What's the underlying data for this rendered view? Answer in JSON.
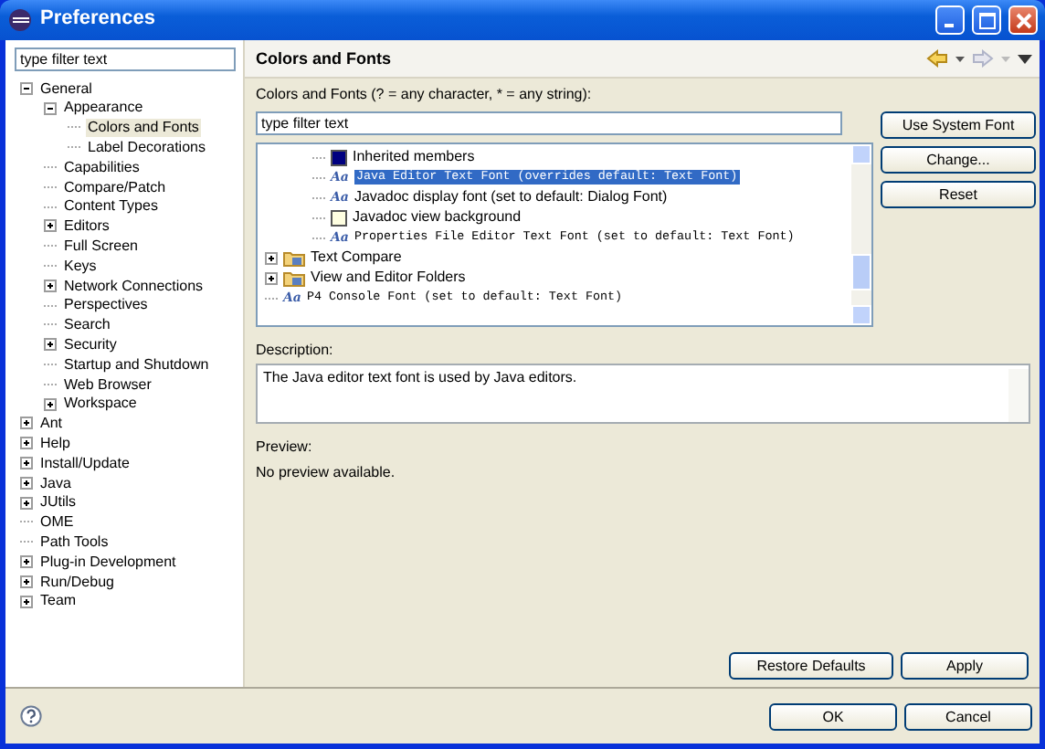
{
  "window": {
    "title": "Preferences"
  },
  "sidebar": {
    "filter": {
      "value": "type filter text"
    },
    "tree": [
      {
        "label": "General",
        "expanded": true,
        "selected": false,
        "children": [
          {
            "label": "Appearance",
            "expanded": true,
            "selected": false,
            "children": [
              {
                "label": "Colors and Fonts",
                "selected": true
              },
              {
                "label": "Label Decorations",
                "selected": false
              }
            ]
          },
          {
            "label": "Capabilities",
            "selected": false
          },
          {
            "label": "Compare/Patch",
            "selected": false
          },
          {
            "label": "Content Types",
            "selected": false
          },
          {
            "label": "Editors",
            "expanded": false,
            "selected": false
          },
          {
            "label": "Full Screen",
            "selected": false
          },
          {
            "label": "Keys",
            "selected": false
          },
          {
            "label": "Network Connections",
            "expanded": false,
            "selected": false
          },
          {
            "label": "Perspectives",
            "selected": false
          },
          {
            "label": "Search",
            "selected": false
          },
          {
            "label": "Security",
            "expanded": false,
            "selected": false
          },
          {
            "label": "Startup and Shutdown",
            "selected": false
          },
          {
            "label": "Web Browser",
            "selected": false
          },
          {
            "label": "Workspace",
            "expanded": false,
            "selected": false
          }
        ]
      },
      {
        "label": "Ant",
        "expanded": false,
        "selected": false
      },
      {
        "label": "Help",
        "expanded": false,
        "selected": false
      },
      {
        "label": "Install/Update",
        "expanded": false,
        "selected": false
      },
      {
        "label": "Java",
        "expanded": false,
        "selected": false
      },
      {
        "label": "JUtils",
        "expanded": false,
        "selected": false
      },
      {
        "label": "OME",
        "selected": false
      },
      {
        "label": "Path Tools",
        "selected": false
      },
      {
        "label": "Plug-in Development",
        "expanded": false,
        "selected": false
      },
      {
        "label": "Run/Debug",
        "expanded": false,
        "selected": false
      },
      {
        "label": "Team",
        "expanded": false,
        "selected": false
      }
    ]
  },
  "page": {
    "title": "Colors and Fonts",
    "filter_label": "Colors and Fonts (? = any character, * = any string):",
    "filter": {
      "value": "type filter text"
    },
    "list": {
      "partial_group": [
        {
          "kind": "color",
          "label": "Inherited members",
          "color": "#000080",
          "selected": false
        },
        {
          "kind": "font",
          "icon": "Aa",
          "label": "Java Editor Text Font (overrides default: Text Font)",
          "monospace": true,
          "selected": true
        },
        {
          "kind": "font",
          "icon": "Aa",
          "label": "Javadoc display font (set to default: Dialog Font)",
          "monospace": false,
          "selected": false
        },
        {
          "kind": "color",
          "label": "Javadoc view background",
          "color": "#ffffe1",
          "selected": false
        },
        {
          "kind": "font",
          "icon": "Aa",
          "label": "Properties File Editor Text Font (set to default: Text Font)",
          "monospace": true,
          "selected": false
        }
      ],
      "items": [
        {
          "kind": "folder",
          "label": "Text Compare",
          "expanded": false,
          "selected": false
        },
        {
          "kind": "folder",
          "label": "View and Editor Folders",
          "expanded": false,
          "selected": false
        },
        {
          "kind": "font",
          "icon": "Aa",
          "label": "P4 Console Font (set to default: Text Font)",
          "monospace": true,
          "selected": false
        }
      ]
    },
    "side_buttons": [
      "Use System Font",
      "Change...",
      "Reset"
    ],
    "description_label": "Description:",
    "description": "The Java editor text font is used by Java editors.",
    "preview_label": "Preview:",
    "preview": "No preview available.",
    "buttons": [
      "Restore Defaults",
      "Apply"
    ]
  },
  "footer_buttons": [
    "OK",
    "Cancel"
  ]
}
